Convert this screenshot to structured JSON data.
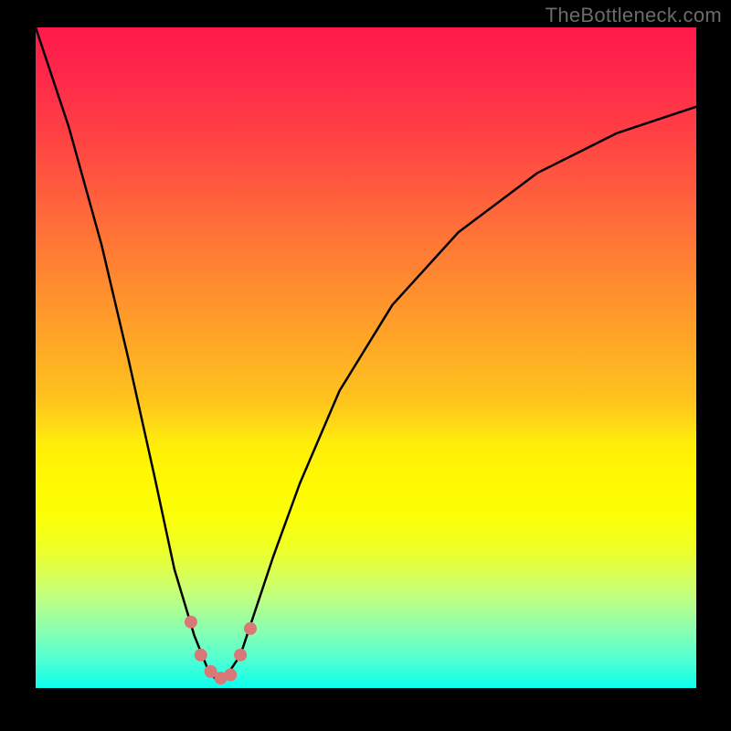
{
  "watermark": "TheBottleneck.com",
  "chart_data": {
    "type": "line",
    "title": "",
    "xlabel": "",
    "ylabel": "",
    "xlim": [
      0,
      100
    ],
    "ylim": [
      0,
      100
    ],
    "series": [
      {
        "name": "bottleneck-curve",
        "x": [
          0,
          5,
          10,
          14,
          18,
          21,
          24,
          26,
          27.5,
          29,
          31,
          33,
          36,
          40,
          46,
          54,
          64,
          76,
          88,
          100
        ],
        "values": [
          100,
          85,
          67,
          50,
          32,
          18,
          8,
          3,
          1,
          2,
          5,
          11,
          20,
          31,
          45,
          58,
          69,
          78,
          84,
          88
        ]
      }
    ],
    "markers": {
      "name": "trough-points",
      "x": [
        23.5,
        25,
        26.5,
        28,
        29.5,
        31,
        32.5
      ],
      "values": [
        10,
        5,
        2.5,
        1.5,
        2,
        5,
        9
      ]
    },
    "gradient_stops": [
      {
        "pos": 0,
        "color": "#ff1a4b"
      },
      {
        "pos": 50,
        "color": "#ffb020"
      },
      {
        "pos": 70,
        "color": "#fff500"
      },
      {
        "pos": 100,
        "color": "#0affee"
      }
    ]
  }
}
